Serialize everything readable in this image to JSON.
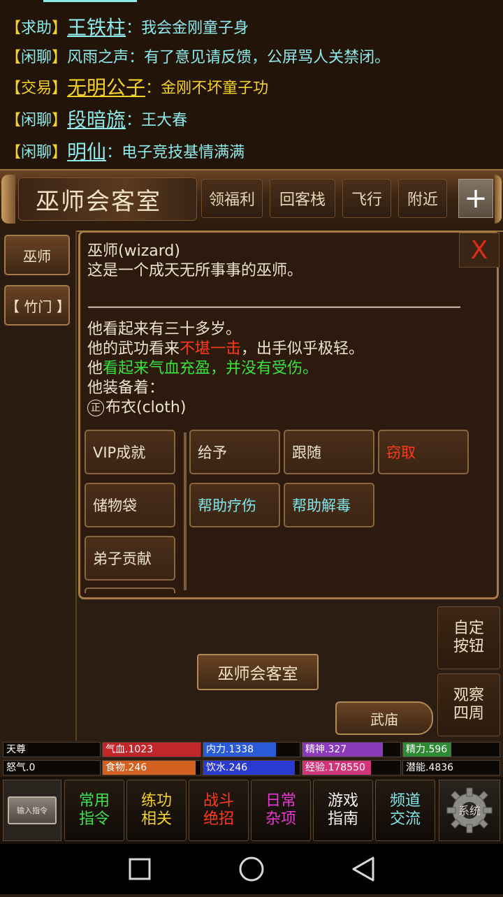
{
  "chat": [
    {
      "channel": "求助",
      "user": "王铁柱",
      "message": "我会金刚童子身"
    },
    {
      "channel": "闲聊",
      "user": "风雨之声",
      "message": "有了意见请反馈，公屏骂人关禁闭。"
    },
    {
      "channel": "交易",
      "user": "无明公子",
      "message": "金刚不坏童子功"
    },
    {
      "channel": "闲聊",
      "user": "段暗旒",
      "message": "王大春"
    },
    {
      "channel": "闲聊",
      "user": "明仙",
      "message": "电子竞技基情满满"
    }
  ],
  "topbar": {
    "room_title": "巫师会客室",
    "buttons": [
      "领福利",
      "回客栈",
      "飞行",
      "附近"
    ],
    "plus": "+"
  },
  "sidebar": {
    "items": [
      "巫师",
      "【 竹门 】"
    ]
  },
  "panel": {
    "close": "X",
    "name": "巫师(wizard)",
    "desc": "这是一个成天无所事事的巫师。",
    "divider": "————————————————————————————",
    "age": "他看起来有三十多岁。",
    "skill_prefix": "他的武功看来",
    "skill_value": "不堪一击",
    "skill_suffix": "，出手似乎极轻。",
    "health_prefix": "他",
    "health_value": "看起来气血充盈，并没有受伤。",
    "equip_label": "他装备着：",
    "equip_mark": "正",
    "equip_item": "布衣(cloth)",
    "left_actions": [
      "VIP成就",
      "储物袋",
      "弟子贡献"
    ],
    "actions": [
      "给予",
      "跟随",
      "窃取",
      "帮助疗伤",
      "帮助解毒"
    ]
  },
  "room_button": "巫师会客室",
  "temple_button": "武庙",
  "right_buttons": [
    "自定\n按钮",
    "观察\n四周"
  ],
  "stats": [
    {
      "label": "天尊",
      "color": "#0c0805",
      "fill": 1.0
    },
    {
      "label": "气血.1023",
      "color": "#c0262a",
      "fill": 1.0
    },
    {
      "label": "内力.1338",
      "color": "#2a5ad6",
      "fill": 0.75
    },
    {
      "label": "精神.327",
      "color": "#8a3ab8",
      "fill": 0.82
    },
    {
      "label": "精力.596",
      "color": "#2e8a34",
      "fill": 0.5
    },
    {
      "label": "怒气.0",
      "color": "#0c0805",
      "fill": 1.0
    },
    {
      "label": "食物.246",
      "color": "#d2601e",
      "fill": 0.95
    },
    {
      "label": "饮水.246",
      "color": "#2a3ad0",
      "fill": 0.95
    },
    {
      "label": "经验.178550",
      "color": "#d0357a",
      "fill": 0.7
    },
    {
      "label": "潜能.4836",
      "color": "#0c0805",
      "fill": 1.0
    }
  ],
  "menu": {
    "input": "输入指令",
    "items": [
      {
        "text": "常用\n指令",
        "color": "#3fe24a"
      },
      {
        "text": "练功\n相关",
        "color": "#f2d12a"
      },
      {
        "text": "战斗\n绝招",
        "color": "#ff3a1a"
      },
      {
        "text": "日常\n杂项",
        "color": "#e63ad6"
      },
      {
        "text": "游戏\n指南",
        "color": "#f2f2f2"
      },
      {
        "text": "频道\n交流",
        "color": "#7fe6ec"
      }
    ],
    "system": "系统"
  }
}
